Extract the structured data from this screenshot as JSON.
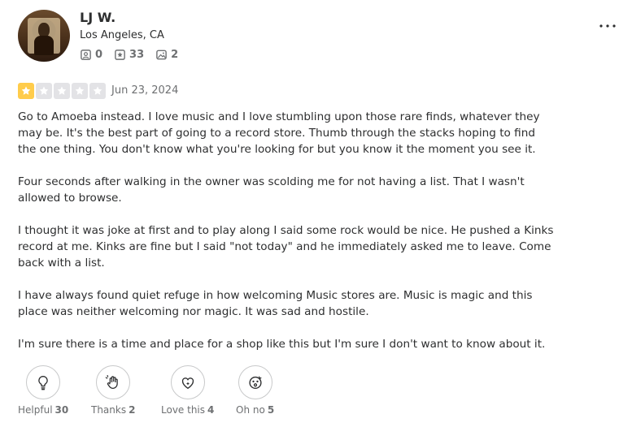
{
  "user": {
    "name": "LJ W.",
    "location": "Los Angeles, CA",
    "friends": "0",
    "reviews": "33",
    "photos": "2"
  },
  "review": {
    "rating": 1,
    "max_rating": 5,
    "date": "Jun 23, 2024",
    "paragraphs": [
      "Go to Amoeba instead. I love music and I love stumbling upon those rare finds, whatever they may be. It's the best part of going to a record store. Thumb through the stacks hoping to find the one thing. You don't know what you're looking for but you know it the moment you see it.",
      "Four seconds after walking in the owner was scolding me for not having a list. That I wasn't allowed to browse.",
      "I thought it was joke at first and to play along I said some rock would be nice. He pushed a Kinks record at me. Kinks are fine but I said \"not today\" and he immediately asked me to leave. Come back with a list.",
      "I have always found quiet refuge in how welcoming Music stores are. Music is magic and this place was neither welcoming nor magic. It was sad and hostile.",
      "I'm sure there is a time and place for a shop like this but I'm sure I don't want to know about it."
    ]
  },
  "reactions": [
    {
      "label": "Helpful",
      "count": "30",
      "icon": "lightbulb-icon"
    },
    {
      "label": "Thanks",
      "count": "2",
      "icon": "wave-hand-icon"
    },
    {
      "label": "Love this",
      "count": "4",
      "icon": "heart-sparkle-icon"
    },
    {
      "label": "Oh no",
      "count": "5",
      "icon": "surprised-face-icon"
    }
  ],
  "menu": {
    "more_label": "..."
  },
  "colors": {
    "star_on": "#ffcc4b",
    "star_off": "#e3e3e6",
    "muted_text": "#6e7072"
  }
}
